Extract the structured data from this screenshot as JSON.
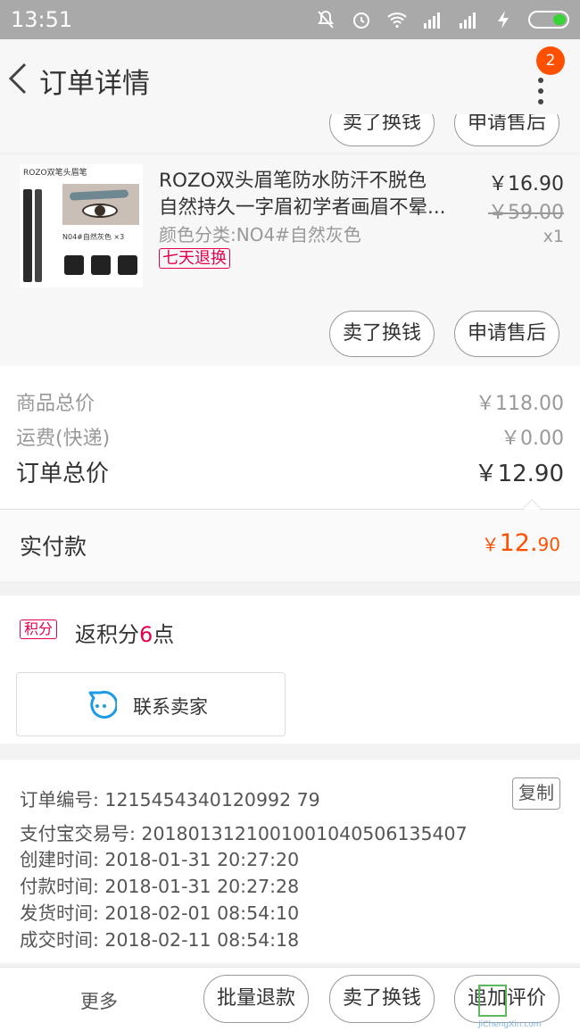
{
  "status_bar": {
    "time": "13:51"
  },
  "header": {
    "title": "订单详情",
    "badge_count": "2"
  },
  "top_actions": {
    "sell": "卖了换钱",
    "after_sale": "申请售后"
  },
  "product": {
    "thumb_label": "ROZO双笔头眉笔",
    "thumb_caption": "N04#自然灰色 ×3",
    "name_line1": "ROZO双头眉笔防水防汗不脱色",
    "name_line2": "自然持久一字眉初学者画眉不晕...",
    "spec": "颜色分类:NO4#自然灰色",
    "tag": "七天退换",
    "price": "￥16.90",
    "original_price": "￥59.00",
    "quantity": "x1",
    "sell_button": "卖了换钱",
    "after_sale_button": "申请售后"
  },
  "summary": {
    "goods_total_label": "商品总价",
    "goods_total_value": "￥118.00",
    "shipping_label": "运费(快递)",
    "shipping_value": "￥0.00",
    "order_total_label": "订单总价",
    "order_total_value": "￥12.90",
    "paid_label": "实付款",
    "paid_currency": "￥",
    "paid_integer": "12.",
    "paid_decimal": "90"
  },
  "points": {
    "tag": "积分",
    "text_prefix": "返积分",
    "value": "6",
    "text_suffix": "点",
    "contact_label": "联系卖家"
  },
  "order_info": {
    "order_no": "订单编号: 1215454340120992 79",
    "alipay_no": "支付宝交易号: 2018013121001001040506135407",
    "created": "创建时间: 2018-01-31 20:27:20",
    "paid": "付款时间: 2018-01-31 20:27:28",
    "shipped": "发货时间: 2018-02-01 08:54:10",
    "completed": "成交时间: 2018-02-11 08:54:18",
    "copy_label": "复制"
  },
  "bottom_bar": {
    "more": "更多",
    "batch_refund": "批量退款",
    "sell": "卖了换钱",
    "review": "追加评价"
  },
  "watermark": {
    "text": "JiChengXin.com"
  },
  "colors": {
    "accent": "#ff5000",
    "tag_red": "#e5004f",
    "status_bar": "#a9a9a9"
  }
}
